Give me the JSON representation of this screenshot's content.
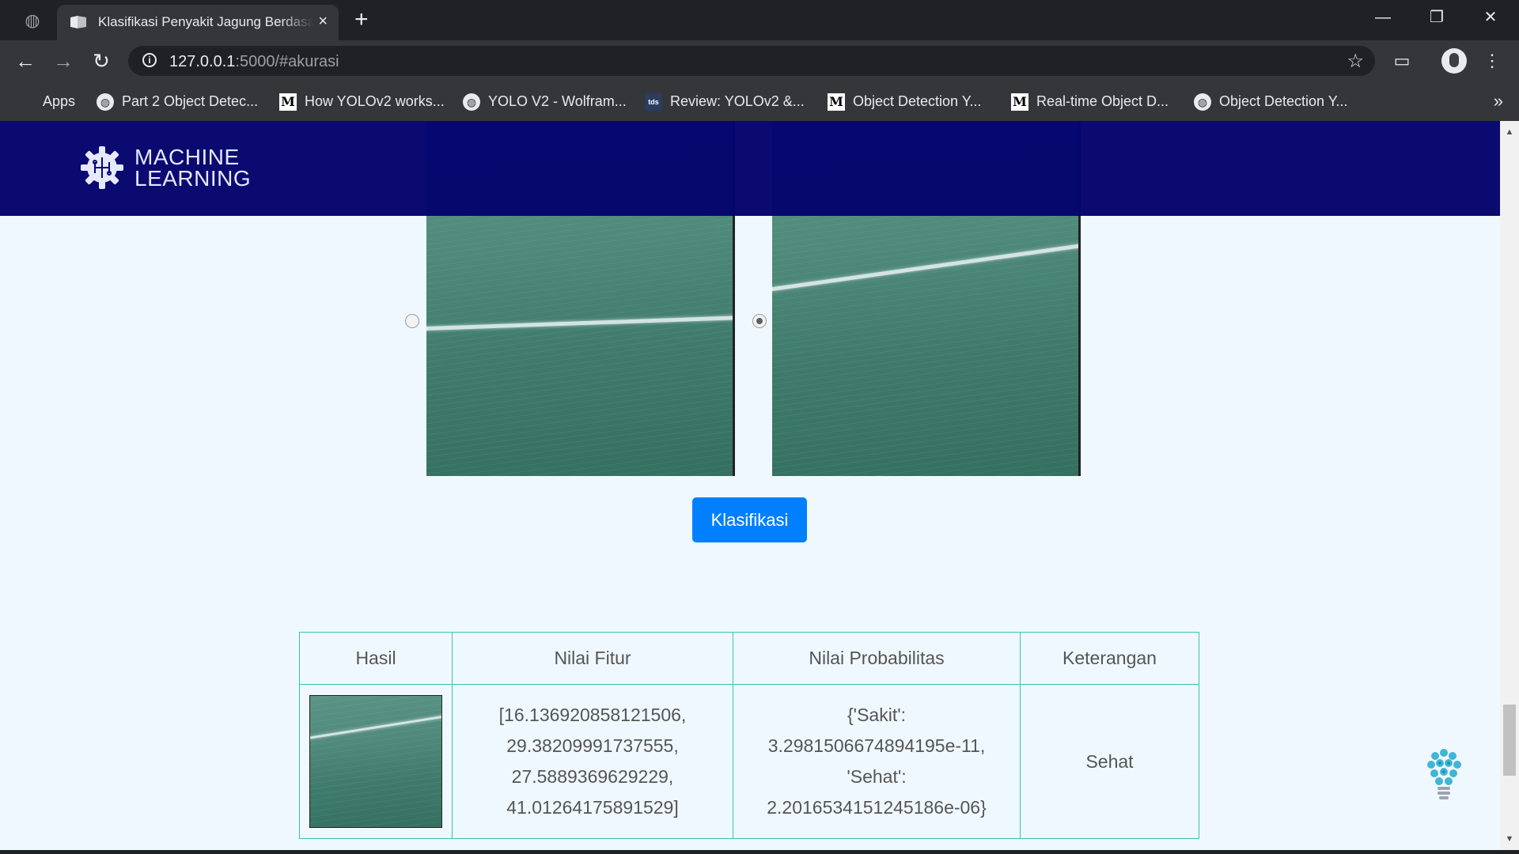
{
  "browser": {
    "tab": {
      "title": "Klasifikasi Penyakit Jagung Berdasarkan",
      "close": "×"
    },
    "new_tab": "+",
    "window_controls": {
      "minimize": "—",
      "restore": "❐",
      "close": "✕"
    },
    "url": {
      "host": "127.0.0.1",
      "rest": ":5000/#akurasi"
    },
    "bookmarks": [
      {
        "label": "Apps",
        "icon": "apps-grid-icon"
      },
      {
        "label": "Part 2 Object Detec...",
        "icon": "globe-icon"
      },
      {
        "label": "How YOLOv2 works...",
        "icon": "medium-icon"
      },
      {
        "label": "YOLO V2 - Wolfram...",
        "icon": "globe-icon"
      },
      {
        "label": "Review: YOLOv2 &...",
        "icon": "tds-icon",
        "icon_text": "tds"
      },
      {
        "label": "Object Detection Y...",
        "icon": "medium-icon"
      },
      {
        "label": "Real-time Object D...",
        "icon": "medium-icon"
      },
      {
        "label": "Object Detection Y...",
        "icon": "globe-icon"
      }
    ],
    "bookmarks_more": "»",
    "colors": {
      "tabstrip": "#202124",
      "toolbar": "#35363a"
    }
  },
  "page": {
    "navbar": {
      "logo_line1": "MACHINE",
      "logo_line2": "LEARNING",
      "bg": "#05056e"
    },
    "images": [
      {
        "name": "leaf-image-1",
        "selected": false
      },
      {
        "name": "leaf-image-2",
        "selected": true
      }
    ],
    "classify_button": "Klasifikasi",
    "table": {
      "headers": [
        "Hasil",
        "Nilai Fitur",
        "Nilai Probabilitas",
        "Keterangan"
      ],
      "row": {
        "features": [
          "[16.136920858121506,",
          "29.38209991737555,",
          "27.5889369629229,",
          "41.01264175891529]"
        ],
        "probabilities": [
          "{'Sakit':",
          "3.2981506674894195e-11,",
          "'Sehat':",
          "2.2016534151245186e-06}"
        ],
        "keterangan": "Sehat"
      }
    },
    "colors": {
      "background": "#f0f8ff",
      "accent": "#0080ff",
      "table_border": "#38c3ad"
    }
  }
}
